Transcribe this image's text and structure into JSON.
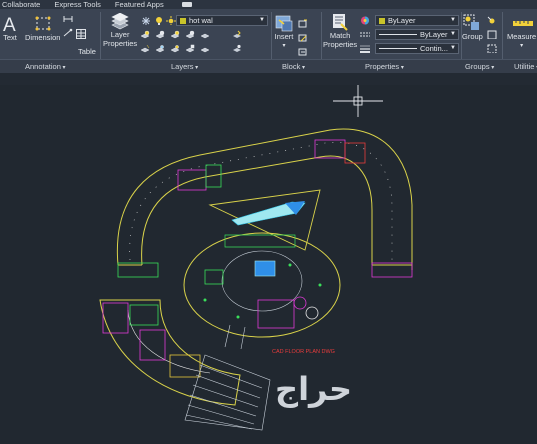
{
  "menubar": {
    "items": [
      "Collaborate",
      "Express Tools",
      "Featured Apps"
    ]
  },
  "ribbon": {
    "annotation": {
      "text_label": "Text",
      "dimension_label": "Dimension",
      "table_label": "Table",
      "panel_label": "Annotation"
    },
    "layers": {
      "layer_properties_line1": "Layer",
      "layer_properties_line2": "Properties",
      "current_layer": "hot wal",
      "panel_label": "Layers"
    },
    "block": {
      "insert_label": "Insert",
      "panel_label": "Block"
    },
    "properties": {
      "match_line1": "Match",
      "match_line2": "Properties",
      "color_value": "ByLayer",
      "linetype_value": "ByLayer",
      "lineweight_value": "Contin...",
      "panel_label": "Properties"
    },
    "groups": {
      "group_label": "Group",
      "panel_label": "Groups"
    },
    "utilities": {
      "measure_label": "Measure",
      "panel_label": "Utilitie"
    }
  },
  "drawing": {
    "annotation_text": "CAD FLOOR PLAN DWG"
  },
  "watermark": {
    "text": "حراج"
  },
  "colors": {
    "accent_yellow": "#c9c42a",
    "canvas_bg": "#212830",
    "ribbon_bg": "#3b4453"
  }
}
